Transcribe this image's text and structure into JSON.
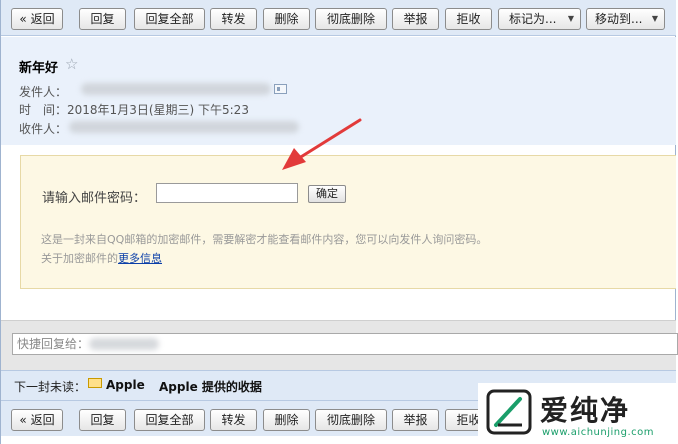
{
  "toolbar": {
    "back": "« 返回",
    "reply": "回复",
    "reply_all": "回复全部",
    "forward": "转发",
    "delete": "删除",
    "delete_permanently": "彻底删除",
    "report": "举报",
    "reject": "拒收",
    "mark_as": "标记为...",
    "move_to": "移动到...",
    "dropdown_icon": "triangle-down"
  },
  "email": {
    "subject": "新年好",
    "star_icon": "☆",
    "sender_label": "发件人：",
    "time_label": "时　间：",
    "time_value": "2018年1月3日(星期三) 下午5:23",
    "recipient_label": "收件人："
  },
  "password_prompt": {
    "label": "请输入邮件密码：",
    "input_value": "",
    "confirm_label": "确定",
    "note": "这是一封来自QQ邮箱的加密邮件，需要解密才能查看邮件内容，您可以向发件人询问密码。",
    "more_prefix": "关于加密邮件的",
    "more_link": "更多信息"
  },
  "quick_reply": {
    "placeholder": "快捷回复给："
  },
  "next_unread": {
    "label": "下一封未读：",
    "sender": "Apple",
    "subject": "Apple 提供的收据"
  },
  "watermark": {
    "brand": "爱纯净",
    "domain": "www.aichunjing.com"
  },
  "colors": {
    "toolbar_bg": "#dfe9f6",
    "header_bg": "#eaf1fb",
    "password_box_bg": "#fdf8e4",
    "arrow": "#e23a3a",
    "link": "#0a3ea8",
    "watermark_green": "#1a9e6a"
  }
}
